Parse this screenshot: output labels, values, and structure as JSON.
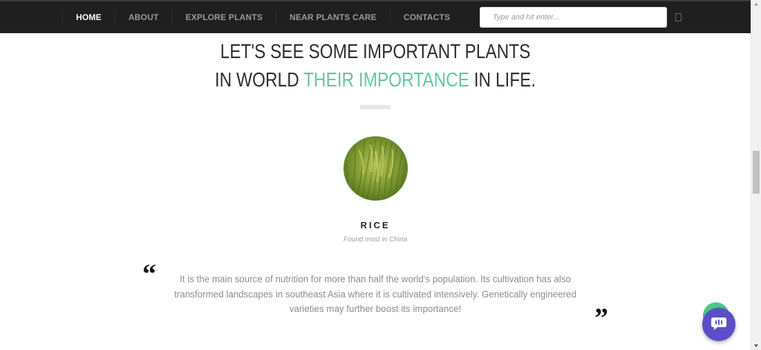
{
  "nav": {
    "items": [
      {
        "label": "HOME",
        "active": true
      },
      {
        "label": "ABOUT",
        "active": false
      },
      {
        "label": "EXPLORE PLANTS",
        "active": false
      },
      {
        "label": "NEAR PLANTS CARE",
        "active": false
      },
      {
        "label": "CONTACTS",
        "active": false
      }
    ],
    "search_placeholder": "Type and hit enter..."
  },
  "section": {
    "heading_line1": "LET'S SEE SOME IMPORTANT PLANTS",
    "heading_line2_prefix": "IN WORLD ",
    "heading_line2_accent": "THEIR IMPORTANCE",
    "heading_line2_suffix": " IN LIFE."
  },
  "plant": {
    "name": "RICE",
    "origin": "Found most in China",
    "quote": "It is the main source of nutrition for more than half the world's population. Its cultivation has also transformed landscapes in southeast Asia where it is cultivated intensively. Genetically engineered varieties may further boost its importance!",
    "quote_open": "“",
    "quote_close": "”"
  },
  "colors": {
    "accent": "#62c89e",
    "navbar": "#1f1f1f",
    "chat": "#5a4fc9"
  },
  "icons": [
    "search-icon",
    "quote-open-icon",
    "quote-close-icon",
    "chat-icon"
  ]
}
